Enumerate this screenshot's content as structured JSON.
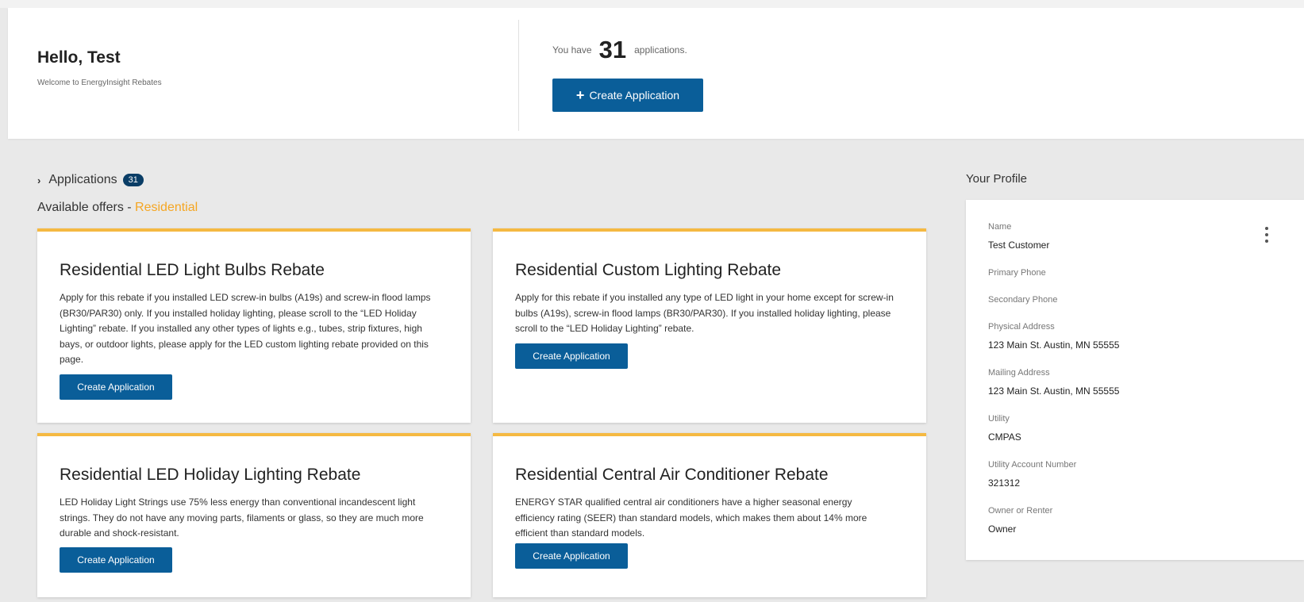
{
  "header": {
    "greeting": "Hello, Test",
    "welcome": "Welcome to EnergyInsight Rebates",
    "count_prefix": "You have",
    "count": "31",
    "count_suffix": "applications.",
    "create_icon": "+",
    "create_label": "Create Application"
  },
  "applications": {
    "label": "Applications",
    "chevron": "›",
    "count": "31"
  },
  "offers": {
    "prefix": "Available offers - ",
    "segment": "Residential"
  },
  "cards": [
    {
      "title": "Residential LED Light Bulbs Rebate",
      "description": "Apply for this rebate if you installed LED screw-in bulbs (A19s) and screw-in flood lamps (BR30/PAR30) only. If you installed holiday lighting, please scroll to the “LED Holiday Lighting” rebate. If you installed any other types of lights e.g., tubes, strip fixtures, high bays, or outdoor lights, please apply for the LED custom lighting rebate provided on this page.",
      "button": "Create Application"
    },
    {
      "title": "Residential Custom Lighting Rebate",
      "description": "Apply for this rebate if you installed any type of LED light in your home except for screw-in bulbs (A19s), screw-in flood lamps (BR30/PAR30). If you installed holiday lighting, please scroll to the “LED Holiday Lighting” rebate.",
      "button": "Create Application"
    },
    {
      "title": "Residential LED Holiday Lighting Rebate",
      "description": "LED Holiday Light Strings use 75% less energy than conventional incandescent light strings. They do not have any moving parts, filaments or glass, so they are much more durable and shock-resistant.",
      "button": "Create Application"
    },
    {
      "title": "Residential Central Air Conditioner Rebate",
      "description": "ENERGY STAR qualified central air conditioners have a higher seasonal energy efficiency rating (SEER) than standard models, which makes them about 14% more efficient than standard models.",
      "button": "Create Application"
    }
  ],
  "profile": {
    "title": "Your Profile",
    "menu_icon": "kebab-menu-icon",
    "fields": [
      {
        "label": "Name",
        "value": "Test Customer"
      },
      {
        "label": "Primary Phone",
        "value": ""
      },
      {
        "label": "Secondary Phone",
        "value": ""
      },
      {
        "label": "Physical Address",
        "value": "123 Main St. Austin, MN 55555"
      },
      {
        "label": "Mailing Address",
        "value": "123 Main St. Austin, MN 55555"
      },
      {
        "label": "Utility",
        "value": "CMPAS"
      },
      {
        "label": "Utility Account Number",
        "value": "321312"
      },
      {
        "label": "Owner or Renter",
        "value": "Owner"
      }
    ]
  },
  "colors": {
    "primary": "#0a5e99",
    "accent": "#f5b942",
    "segment": "#f5a623",
    "badge": "#0a3d66",
    "background": "#e9e9e9"
  }
}
